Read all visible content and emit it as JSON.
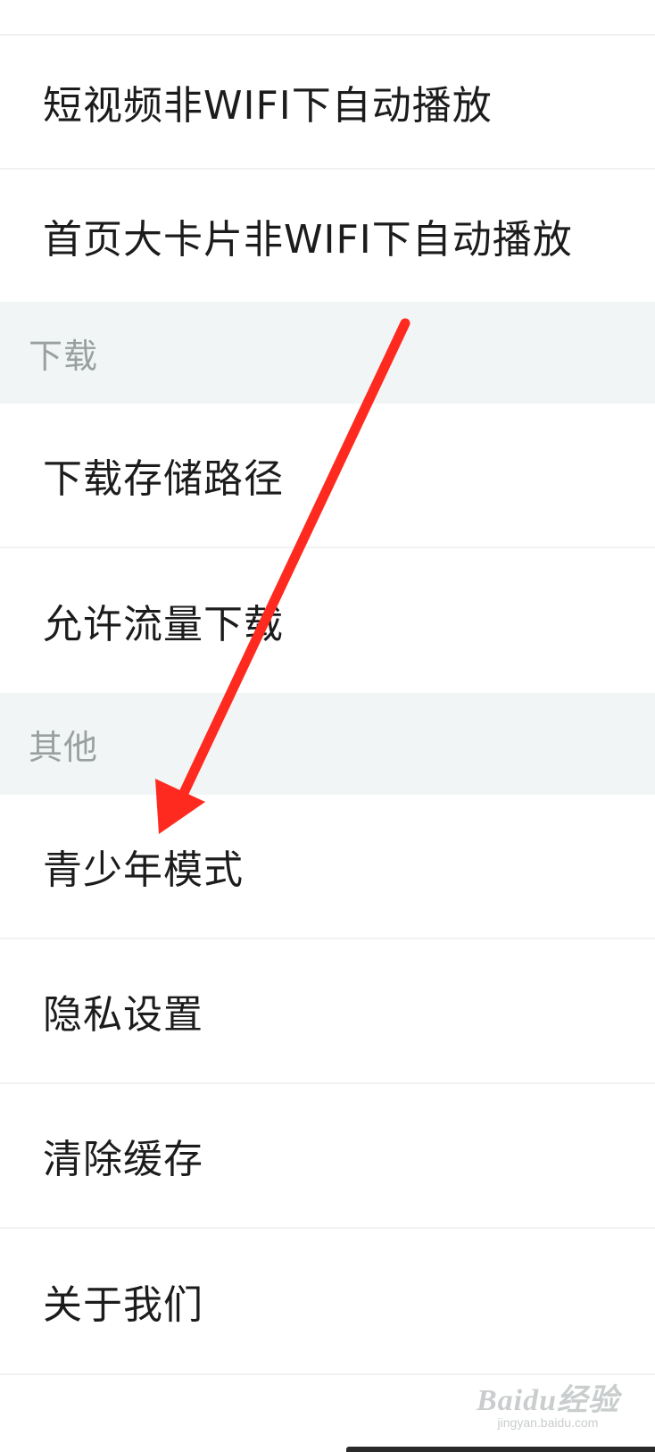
{
  "settings": {
    "items": [
      {
        "label": "短视频非WIFI下自动播放"
      },
      {
        "label": "首页大卡片非WIFI下自动播放"
      }
    ],
    "sections": [
      {
        "title": "下载",
        "items": [
          {
            "label": "下载存储路径"
          },
          {
            "label": "允许流量下载"
          }
        ]
      },
      {
        "title": "其他",
        "items": [
          {
            "label": "青少年模式"
          },
          {
            "label": "隐私设置"
          },
          {
            "label": "清除缓存"
          },
          {
            "label": "关于我们"
          }
        ]
      }
    ]
  },
  "annotation": {
    "arrow_color": "#ff2a1f",
    "arrow_points_to": "青少年模式"
  },
  "watermark": {
    "main": "Baidu经验",
    "sub": "jingyan.baidu.com"
  }
}
